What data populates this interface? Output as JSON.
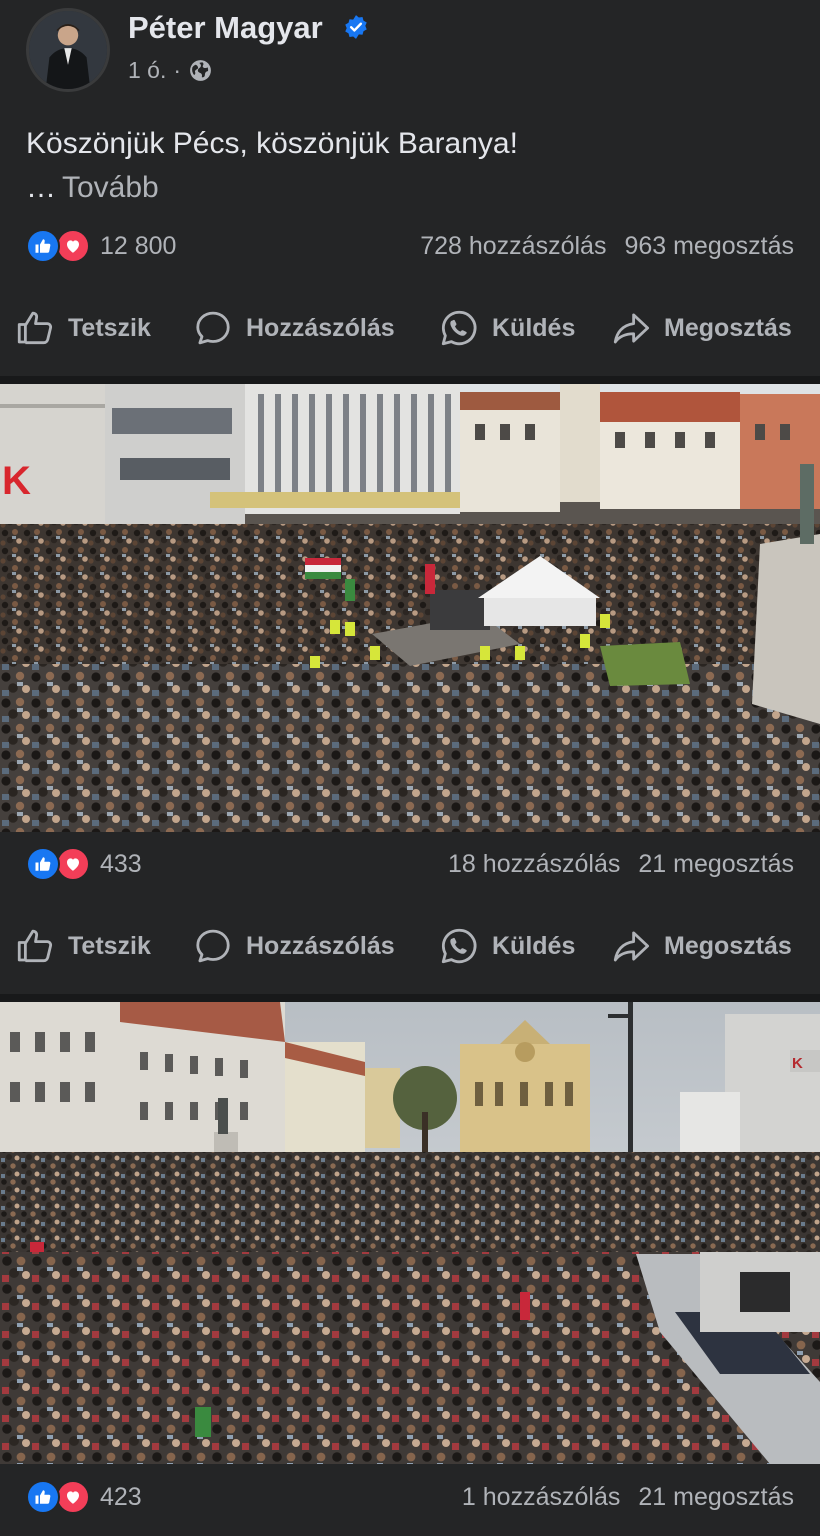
{
  "post": {
    "author": "Péter Magyar",
    "time": "1 ó.",
    "separator_dot": "·",
    "text": "Köszönjük Pécs, köszönjük Baranya!",
    "ellipsis": "…",
    "see_more": "Tovább",
    "reaction_count": "12 800",
    "comments": "728 hozzászólás",
    "shares": "963 megosztás"
  },
  "actions": {
    "like": "Tetszik",
    "comment": "Hozzászólás",
    "send": "Küldés",
    "share": "Megosztás"
  },
  "photos": [
    {
      "reaction_count": "433",
      "comments": "18 hozzászólás",
      "shares": "21 megosztás"
    },
    {
      "reaction_count": "423",
      "comments": "1 hozzászólás",
      "shares": "21 megosztás"
    }
  ],
  "colors": {
    "background": "#242526",
    "separator": "#18191a",
    "primary_text": "#e4e6eb",
    "secondary_text": "#b0b3b8",
    "like_blue": "#1877f2",
    "love_red": "#f33e58"
  },
  "icons": [
    "verified-badge-icon",
    "globe-icon",
    "like-reaction-icon",
    "love-reaction-icon",
    "thumbs-up-icon",
    "comment-bubble-icon",
    "whatsapp-icon",
    "share-arrow-icon"
  ]
}
